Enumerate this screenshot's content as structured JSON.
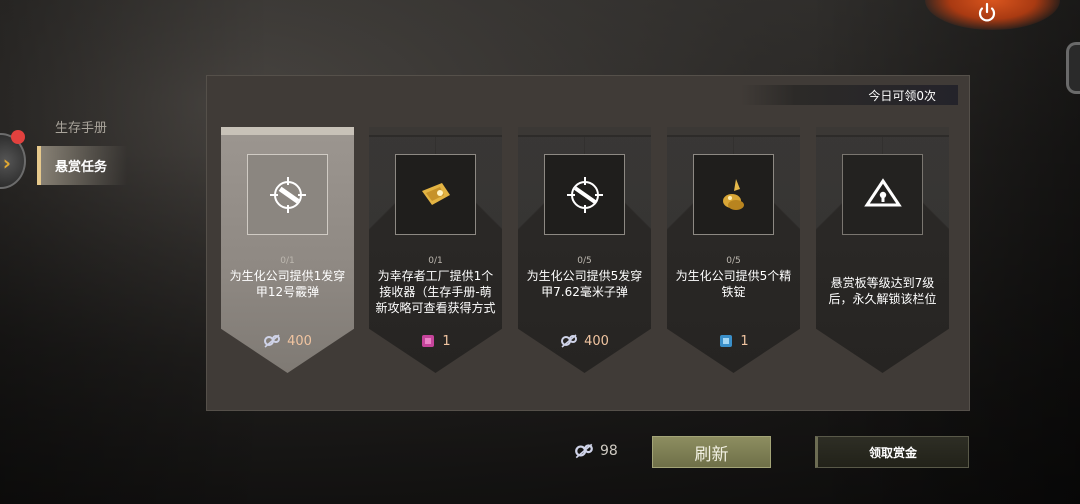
{
  "nav": {
    "items": [
      {
        "label": "生存手册"
      },
      {
        "label": "悬赏任务"
      }
    ]
  },
  "header": {
    "daily_claims": "今日可领0次"
  },
  "cards": [
    {
      "progress": "0/1",
      "description": "为生化公司提供1发穿甲12号霰弹",
      "reward_icon": "gear-parts-icon",
      "reward_qty": "400",
      "item_icon": "shotgun-shell-icon"
    },
    {
      "progress": "0/1",
      "description": "为幸存者工厂提供1个接收器（生存手册-萌新攻略可查看获得方式",
      "reward_icon": "pink-crate-icon",
      "reward_qty": "1",
      "item_icon": "receiver-part-icon"
    },
    {
      "progress": "0/5",
      "description": "为生化公司提供5发穿甲7.62毫米子弹",
      "reward_icon": "gear-parts-icon",
      "reward_qty": "400",
      "item_icon": "rifle-ammo-icon"
    },
    {
      "progress": "0/5",
      "description": "为生化公司提供5个精铁锭",
      "reward_icon": "blue-crate-icon",
      "reward_qty": "1",
      "item_icon": "iron-ingot-icon"
    },
    {
      "progress": "",
      "description": "悬赏板等级达到7级后，永久解锁该栏位",
      "reward_icon": "",
      "reward_qty": "",
      "item_icon": "lock-icon"
    }
  ],
  "footer": {
    "currency_amount": "98",
    "currency_icon": "gear-parts-icon",
    "refresh_label": "刷新",
    "claim_label": "领取赏金"
  },
  "colors": {
    "refresh_button": "#7d7e55",
    "power_glow": "#d9551e",
    "nav_indicator": "#e7c98c",
    "notification_dot": "#e2413e"
  }
}
